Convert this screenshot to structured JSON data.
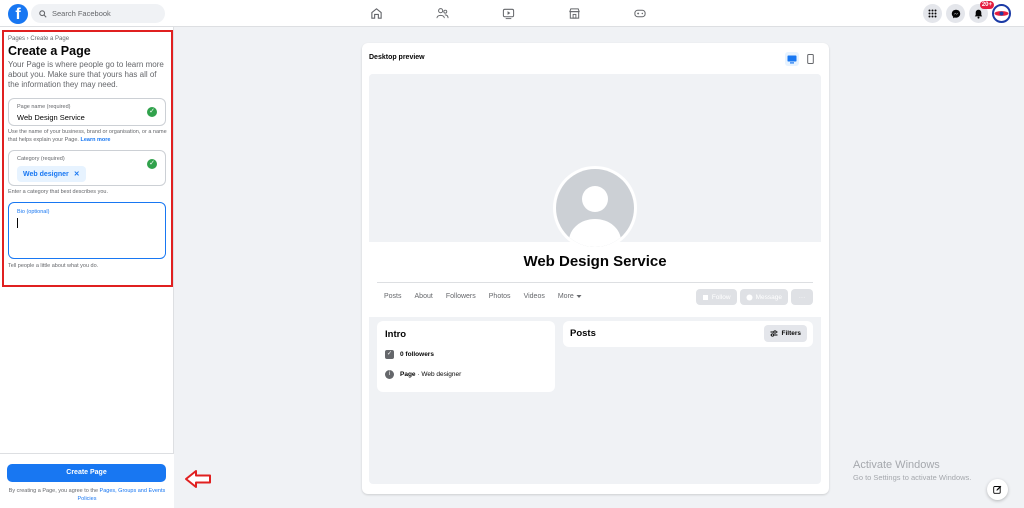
{
  "header": {
    "logo": "f",
    "search_placeholder": "Search Facebook",
    "nav_icons": [
      "home-icon",
      "friends-icon",
      "video-icon",
      "marketplace-icon",
      "gaming-icon"
    ],
    "notification_badge": "20+"
  },
  "form": {
    "breadcrumb": "Pages › Create a Page",
    "title": "Create a Page",
    "intro": "Your Page is where people go to learn more about you. Make sure that yours has all of the information they may need.",
    "page_name": {
      "label": "Page name (required)",
      "value": "Web Design Service",
      "helper": "Use the name of your business, brand or organisation, or a name that helps explain your Page.",
      "learn_more": "Learn more"
    },
    "category": {
      "label": "Category (required)",
      "chip": "Web designer",
      "chip_remove": "✕",
      "helper": "Enter a category that best describes you."
    },
    "bio": {
      "label": "Bio (optional)",
      "helper": "Tell people a little about what you do."
    },
    "create_button": "Create Page",
    "terms_prefix": "By creating a Page, you agree to the",
    "terms_link": "Pages, Groups and Events Policies"
  },
  "preview": {
    "title": "Desktop preview",
    "page_name": "Web Design Service",
    "tabs": [
      "Posts",
      "About",
      "Followers",
      "Photos",
      "Videos",
      "More"
    ],
    "follow": "Follow",
    "message": "Message",
    "more_dots": "···",
    "intro_title": "Intro",
    "followers": "0 followers",
    "page_type_bold": "Page",
    "page_type_rest": " · Web designer",
    "posts_title": "Posts",
    "filters": "Filters"
  },
  "watermark": {
    "line1": "Activate Windows",
    "line2": "Go to Settings to activate Windows."
  },
  "colors": {
    "brand": "#1877f2",
    "success": "#31a24c",
    "highlight": "#e02020"
  }
}
